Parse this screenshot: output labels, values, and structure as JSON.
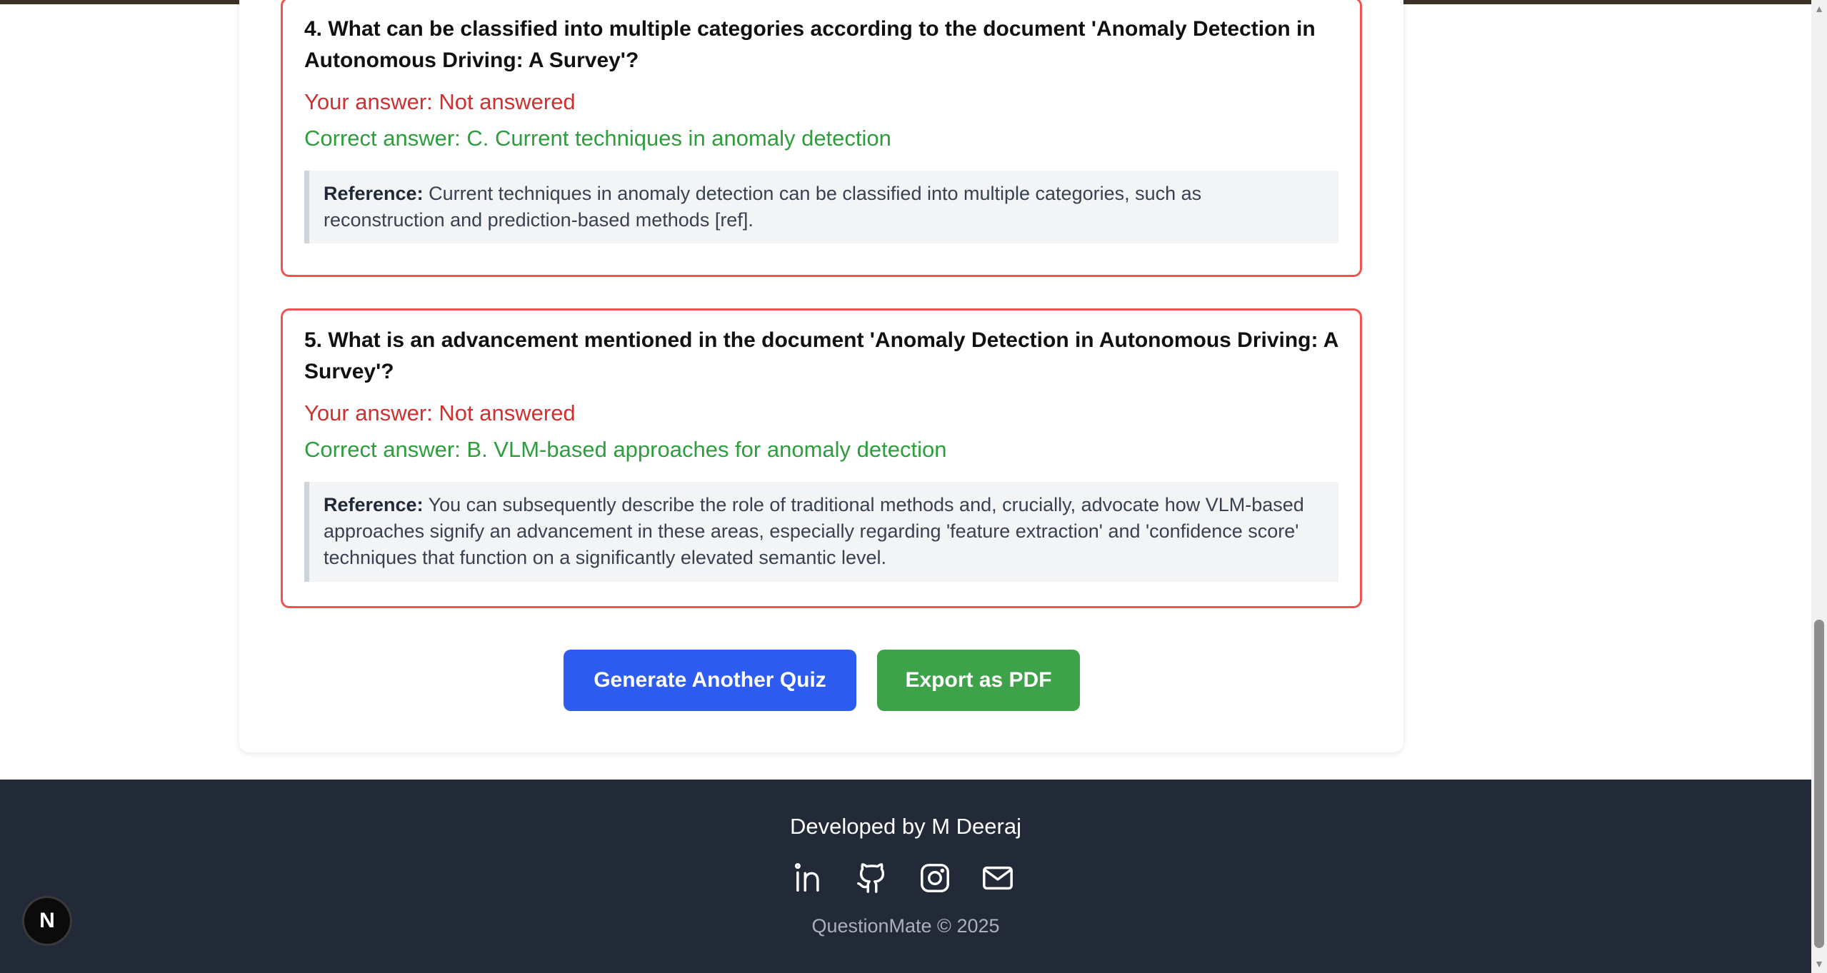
{
  "results": {
    "q4": {
      "question": "4. What can be classified into multiple categories according to the document 'Anomaly Detection in Autonomous Driving: A Survey'?",
      "your_answer": "Your answer: Not answered",
      "correct_answer": "Correct answer: C. Current techniques in anomaly detection",
      "reference_label": "Reference:",
      "reference_text": " Current techniques in anomaly detection can be classified into multiple categories, such as reconstruction and prediction-based methods [ref]."
    },
    "q5": {
      "question": "5. What is an advancement mentioned in the document 'Anomaly Detection in Autonomous Driving: A Survey'?",
      "your_answer": "Your answer: Not answered",
      "correct_answer": "Correct answer: B. VLM-based approaches for anomaly detection",
      "reference_label": "Reference:",
      "reference_text": " You can subsequently describe the role of traditional methods and, crucially, advocate how VLM-based approaches signify an advancement in these areas, especially regarding 'feature extraction' and 'confidence score' techniques that function on a significantly elevated semantic level."
    }
  },
  "actions": {
    "generate_label": "Generate Another Quiz",
    "export_label": "Export as PDF"
  },
  "footer": {
    "developer": "Developed by M Deeraj",
    "copyright": "QuestionMate © 2025",
    "socials": [
      "linkedin-icon",
      "github-icon",
      "instagram-icon",
      "mail-icon"
    ]
  },
  "badge": {
    "letter": "N"
  },
  "colors": {
    "wrong": "#d32f2f",
    "correct": "#2e9d3d",
    "card_border": "#ef5350",
    "primary_button": "#2f5cf0",
    "export_button": "#3ea24a",
    "footer_bg": "#222a38"
  }
}
